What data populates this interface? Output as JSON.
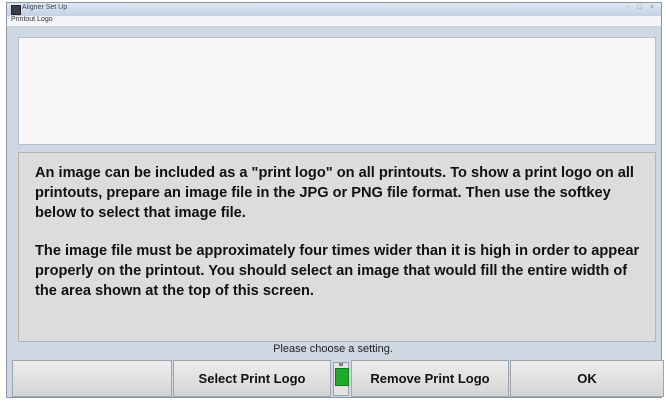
{
  "window": {
    "title": "Aligner Set Up",
    "controls": "- □ ×"
  },
  "menubar": {
    "label": "Printout Logo"
  },
  "info": {
    "paragraph1": "An image can be included as a \"print logo\"  on all printouts.  To show a print logo on all printouts, prepare an image file in the JPG or PNG file format.  Then use the softkey below to select that image file.",
    "paragraph2": "The image file must be approximately four times wider than it is high in order to appear properly on the printout.     You should select an image that would fill the entire width of the area shown at the top of this screen."
  },
  "status": "Please choose a setting.",
  "softkeys": {
    "k1": "",
    "k2": "Select Print Logo",
    "k3": "Remove Print Logo",
    "k4": "OK"
  },
  "colors": {
    "indicator": "#1faa2c"
  }
}
